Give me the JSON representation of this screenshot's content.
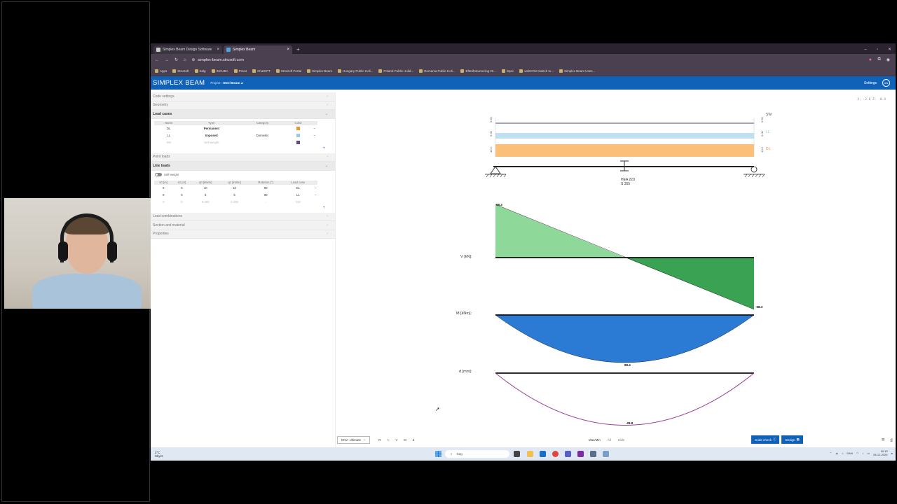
{
  "browser": {
    "tabs": [
      {
        "label": "Simplex Beam Design Software",
        "active": false
      },
      {
        "label": "Simplex Beam",
        "active": true
      }
    ],
    "url": "simplex-beam.strusoft.com",
    "bookmarks": [
      "Apps",
      "StruSoft",
      "Salg",
      "INCUBA",
      "Privat",
      "ChatGPT",
      "StruSoft Portal",
      "Simplex Beam",
      "Hungary Public Holi...",
      "Poland Public Holid...",
      "Romania Public Holi...",
      "Efterårsturnering 20...",
      "Spec",
      "webCRM Switch to...",
      "Simplex Beam Uses..."
    ]
  },
  "app": {
    "logo": "SIMPLEX BEAM",
    "project_label": "Project :",
    "project_name": "Steel Beam",
    "settings": "Settings",
    "avatar": "AN",
    "coords": "X: -2.6 Z: -0.4"
  },
  "left_panel": {
    "sections_top": [
      "Code settings",
      "Geometry"
    ],
    "load_cases_title": "Load cases",
    "load_cases_headers": [
      "Name",
      "Type",
      "Category",
      "Color"
    ],
    "load_cases": [
      {
        "name": "DL",
        "type": "Permanent",
        "category": "",
        "color": "#f0932b",
        "ghost": false
      },
      {
        "name": "LL",
        "type": "Imposed",
        "category": "Domestic",
        "color": "#9cc9e6",
        "ghost": false
      },
      {
        "name": "SW",
        "type": "Self-weight",
        "category": "",
        "color": "#5e4b8b",
        "ghost": true
      }
    ],
    "point_loads": "Point loads",
    "line_loads_title": "Line loads",
    "self_weight_toggle": "Self-weight",
    "line_headers": [
      "x0 [m]",
      "x1 [m]",
      "q0 [kN/m]",
      "q1 [kN/m]",
      "Rotation [°]",
      "Load case"
    ],
    "line_loads": [
      {
        "cells": [
          "0",
          "6",
          "10",
          "10",
          "90",
          "DL"
        ],
        "ghost": false
      },
      {
        "cells": [
          "0",
          "6",
          "5",
          "5",
          "90",
          "LL"
        ],
        "ghost": false
      },
      {
        "cells": [
          "0",
          "6",
          "0.495",
          "0.495",
          "-",
          "SW"
        ],
        "ghost": true
      }
    ],
    "sections_bottom": [
      "Load combinations",
      "Section and material",
      "Properties"
    ]
  },
  "diagram": {
    "load_labels": [
      "SW",
      "LL",
      "DL"
    ],
    "load_values": [
      "0.50",
      "5.00",
      "10.0"
    ],
    "section": "HEA 220",
    "material": "S 355",
    "v_label": "V [kN]:",
    "m_label": "M [kNm]:",
    "d_label": "d [mm]:",
    "v_max": "58.3",
    "v_min": "-58.3",
    "m_max": "88.4",
    "d_max": "-28.8",
    "colors": {
      "sw": "#4a4a70",
      "ll": "#bfe0f2",
      "dl": "#fbbf79",
      "v_pos": "#8ed89a",
      "v_neg": "#3aa253",
      "moment": "#2b7bd4",
      "deflection": "#9b3f97"
    }
  },
  "bottom": {
    "env": "ENV: Ultimate",
    "toggles": [
      "R",
      "N",
      "V",
      "M",
      "d"
    ],
    "views": [
      "Max/Min",
      "All",
      "Hide"
    ],
    "code_check": "Code check",
    "design": "Design"
  },
  "taskbar": {
    "temp": "2°C",
    "weather": "Skyet",
    "search": "Søg",
    "lang": "DAN",
    "time": "10:13",
    "date": "04-12-2024"
  }
}
